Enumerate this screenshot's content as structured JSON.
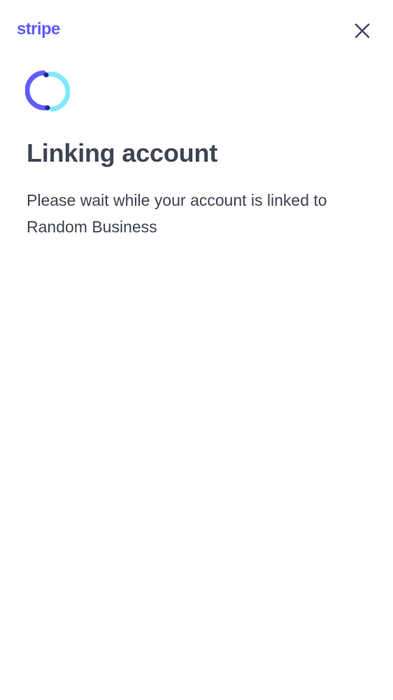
{
  "header": {
    "logo_text": "stripe",
    "close_icon": "close-icon"
  },
  "main": {
    "spinner_icon": "sync-icon",
    "title": "Linking account",
    "message": "Please wait while your account is linked to Random Business"
  },
  "colors": {
    "brand": "#635bff",
    "spinner_primary": "#635bff",
    "spinner_secondary": "#80e9ff",
    "text": "#414552",
    "close": "#424770"
  }
}
